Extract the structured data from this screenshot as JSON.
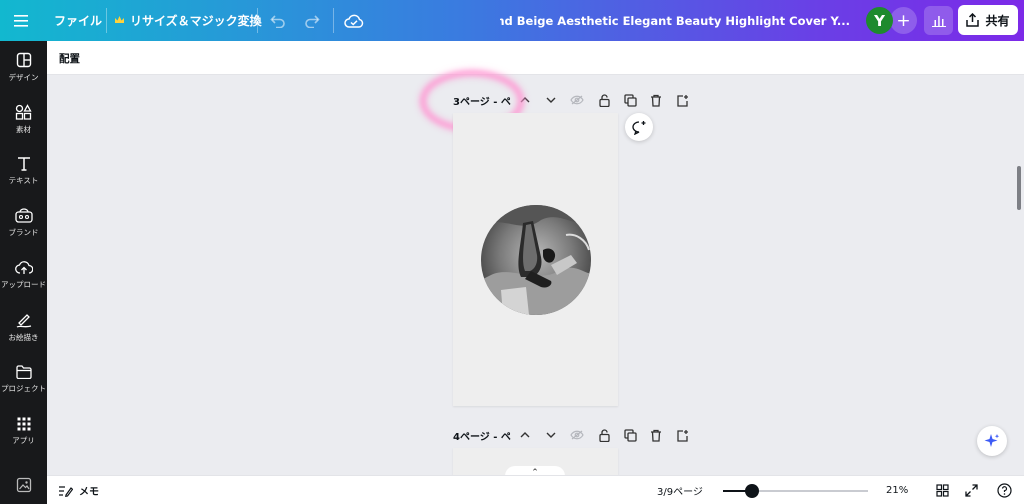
{
  "topbar": {
    "file_label": "ファイル",
    "resize_label": "リサイズ＆マジック変換",
    "doc_title": "Grey and Beige Aesthetic Elegant Beauty  Highlight Cover Y...",
    "avatar_letter": "Y",
    "share_label": "共有"
  },
  "rail": {
    "items": [
      {
        "label": "デザイン",
        "icon": "design-icon"
      },
      {
        "label": "素材",
        "icon": "elements-icon"
      },
      {
        "label": "テキスト",
        "icon": "text-icon"
      },
      {
        "label": "ブランド",
        "icon": "brand-icon"
      },
      {
        "label": "アップロード",
        "icon": "upload-icon"
      },
      {
        "label": "お絵描き",
        "icon": "draw-icon"
      },
      {
        "label": "プロジェクト",
        "icon": "projects-icon"
      },
      {
        "label": "アプリ",
        "icon": "apps-icon"
      }
    ]
  },
  "subbar": {
    "arrange_label": "配置"
  },
  "pages": [
    {
      "label": "3ページ - ペ..."
    },
    {
      "label": "4ページ - ペ..."
    }
  ],
  "bottombar": {
    "notes_label": "メモ",
    "page_indicator": "3/9ページ",
    "zoom_label": "21%",
    "zoom_fraction": 0.2
  },
  "colors": {
    "avatar": "#1e8a2e",
    "rail_bg": "#18191b",
    "highlight": "#ff96d2"
  }
}
